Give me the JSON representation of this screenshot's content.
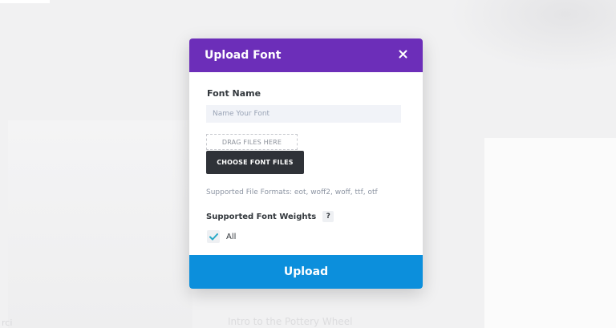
{
  "background": {
    "footer_left": "rci",
    "footer_center": "Intro to the Pottery Wheel"
  },
  "modal": {
    "title": "Upload Font",
    "close_icon": "close-icon",
    "font_name_label": "Font Name",
    "font_name_placeholder": "Name Your Font",
    "font_name_value": "",
    "drag_label": "DRAG FILES HERE",
    "choose_button": "CHOOSE FONT FILES",
    "supported_formats": "Supported File Formats: eot, woff2, woff, ttf, otf",
    "weights_label": "Supported Font Weights",
    "help_badge": "?",
    "weights_option": {
      "label": "All",
      "checked": true
    },
    "upload_button": "Upload"
  },
  "colors": {
    "header": "#6c2eb9",
    "upload": "#0c8fdc",
    "choose_button": "#2f3238",
    "checkmark": "#27a8c7"
  }
}
